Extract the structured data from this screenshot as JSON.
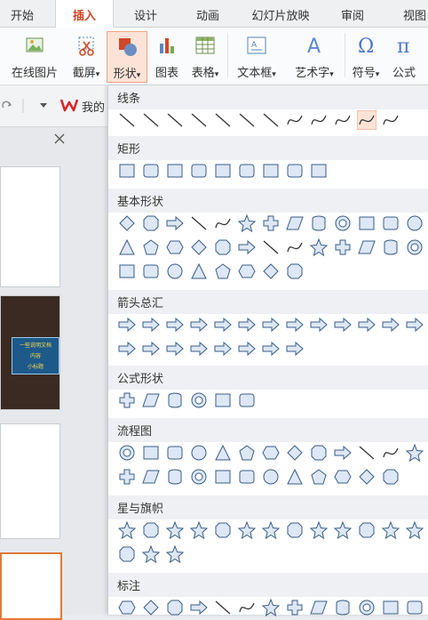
{
  "tabs": [
    "开始",
    "插入",
    "设计",
    "动画",
    "幻灯片放映",
    "审阅",
    "视图"
  ],
  "active_tab": "插入",
  "ribbon": {
    "buttons": [
      {
        "label": "在线图片",
        "icon": "online-picture-icon"
      },
      {
        "label": "截屏",
        "icon": "screenshot-icon",
        "dropdown": true
      },
      {
        "label": "形状",
        "icon": "shapes-icon",
        "dropdown": true,
        "selected": true
      },
      {
        "label": "图表",
        "icon": "chart-icon"
      },
      {
        "label": "表格",
        "icon": "table-icon",
        "dropdown": true
      },
      {
        "label": "文本框",
        "icon": "textbox-icon",
        "dropdown": true
      },
      {
        "label": "艺术字",
        "icon": "wordart-icon",
        "dropdown": true
      },
      {
        "label": "符号",
        "icon": "symbol-icon",
        "dropdown": true
      },
      {
        "label": "公式",
        "icon": "formula-icon"
      }
    ],
    "dropdown_arrow": "▾"
  },
  "quickbar": {
    "wps_label": "我的"
  },
  "shapes_panel": {
    "sections": [
      {
        "title": "线条",
        "count": 12
      },
      {
        "title": "矩形",
        "count": 9
      },
      {
        "title": "基本形状",
        "count": 34
      },
      {
        "title": "箭头总汇",
        "count": 21
      },
      {
        "title": "公式形状",
        "count": 6
      },
      {
        "title": "流程图",
        "count": 25
      },
      {
        "title": "星与旗帜",
        "count": 16
      },
      {
        "title": "标注",
        "count": 13
      }
    ]
  },
  "slide_preview": {
    "line1": "一些说明文档",
    "line2": "内容",
    "line3": "小标题"
  },
  "colors": {
    "accent": "#d24726",
    "shape_stroke": "#3a5c88",
    "shape_fill": "#dde7f5",
    "selected_bg": "#fde3d7"
  }
}
